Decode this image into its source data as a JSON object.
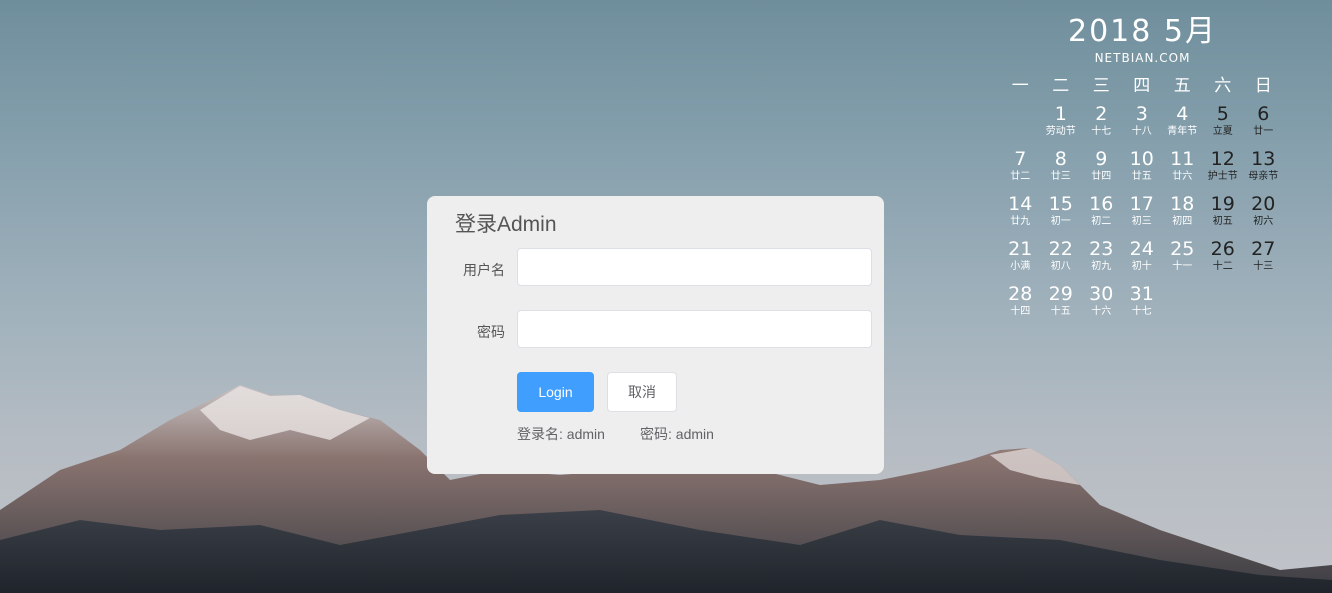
{
  "login": {
    "title": "登录Admin",
    "username_label": "用户名",
    "username_value": "",
    "password_label": "密码",
    "password_value": "",
    "login_button": "Login",
    "cancel_button": "取消",
    "hint_username": "登录名: admin",
    "hint_password": "密码: admin",
    "primary_color": "#409eff"
  },
  "calendar": {
    "title": "2018 5月",
    "site": "NETBIAN.COM",
    "weekdays": [
      "一",
      "二",
      "三",
      "四",
      "五",
      "六",
      "日"
    ],
    "weeks": [
      [
        null,
        {
          "d": "1",
          "l": "劳动节"
        },
        {
          "d": "2",
          "l": "十七"
        },
        {
          "d": "3",
          "l": "十八"
        },
        {
          "d": "4",
          "l": "青年节"
        },
        {
          "d": "5",
          "l": "立夏"
        },
        {
          "d": "6",
          "l": "廿一"
        }
      ],
      [
        {
          "d": "7",
          "l": "廿二"
        },
        {
          "d": "8",
          "l": "廿三"
        },
        {
          "d": "9",
          "l": "廿四"
        },
        {
          "d": "10",
          "l": "廿五"
        },
        {
          "d": "11",
          "l": "廿六"
        },
        {
          "d": "12",
          "l": "护士节"
        },
        {
          "d": "13",
          "l": "母亲节"
        }
      ],
      [
        {
          "d": "14",
          "l": "廿九"
        },
        {
          "d": "15",
          "l": "初一"
        },
        {
          "d": "16",
          "l": "初二"
        },
        {
          "d": "17",
          "l": "初三"
        },
        {
          "d": "18",
          "l": "初四"
        },
        {
          "d": "19",
          "l": "初五"
        },
        {
          "d": "20",
          "l": "初六"
        }
      ],
      [
        {
          "d": "21",
          "l": "小满"
        },
        {
          "d": "22",
          "l": "初八"
        },
        {
          "d": "23",
          "l": "初九"
        },
        {
          "d": "24",
          "l": "初十"
        },
        {
          "d": "25",
          "l": "十一"
        },
        {
          "d": "26",
          "l": "十二"
        },
        {
          "d": "27",
          "l": "十三"
        }
      ],
      [
        {
          "d": "28",
          "l": "十四"
        },
        {
          "d": "29",
          "l": "十五"
        },
        {
          "d": "30",
          "l": "十六"
        },
        {
          "d": "31",
          "l": "十七"
        },
        null,
        null,
        null
      ]
    ]
  }
}
